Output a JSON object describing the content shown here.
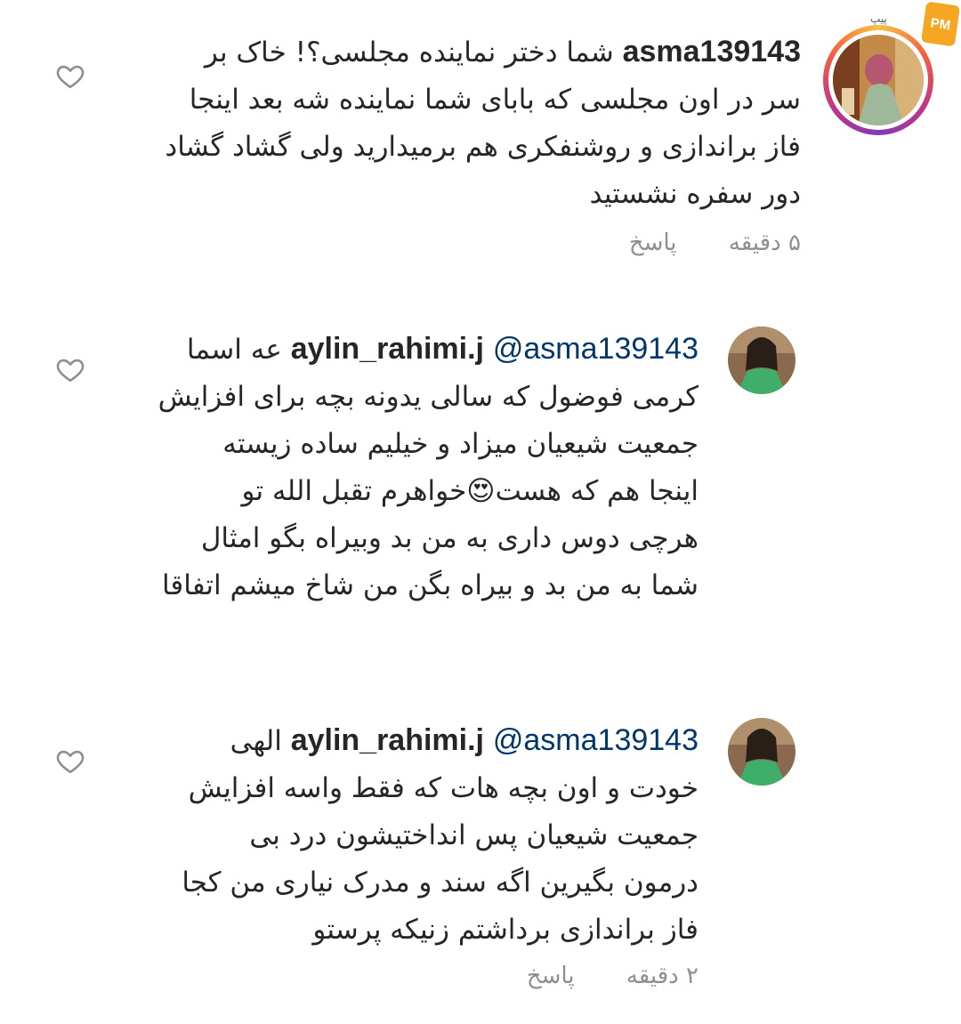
{
  "watermark": {
    "text": "پیپ",
    "badge": "PM"
  },
  "comments": [
    {
      "username": "asma139143",
      "lines": [
        "شما دختر نماینده مجلسی؟! خاک بر",
        "سر در اون مجلسی که بابای شما نماینده شه بعد اینجا",
        "فاز براندازی و روشنفکری هم برمیدارید ولی گشاد گشاد",
        "دور سفره نشستید"
      ],
      "time": "۵ دقیقه",
      "reply": "پاسخ"
    },
    {
      "username": "aylin_rahimi.j",
      "mention": "@asma139143",
      "lines": [
        "عه اسما",
        "کرمی فوضول که سالی یدونه بچه برای افزایش",
        "جمعیت شیعیان میزاد و خیلیم ساده زیسته",
        "اینجا هم که هست😍خواهرم تقبل الله تو",
        "هرچی دوس داری به من بد وبیراه بگو امثال",
        "شما به من بد و بیراه بگن من شاخ میشم اتفاقا"
      ]
    },
    {
      "username": "aylin_rahimi.j",
      "mention": "@asma139143",
      "lines": [
        "الهی",
        "خودت و اون بچه هات که فقط واسه افزایش",
        "جمعیت شیعیان پس انداختیشون درد بی",
        "درمون بگیرین اگه سند و مدرک نیاری من کجا",
        "فاز براندازی برداشتم زنیکه پرستو"
      ],
      "time": "۲ دقیقه",
      "reply": "پاسخ"
    }
  ],
  "colors": {
    "text": "#262626",
    "mention": "#00376b",
    "meta": "#8e8e8e"
  }
}
